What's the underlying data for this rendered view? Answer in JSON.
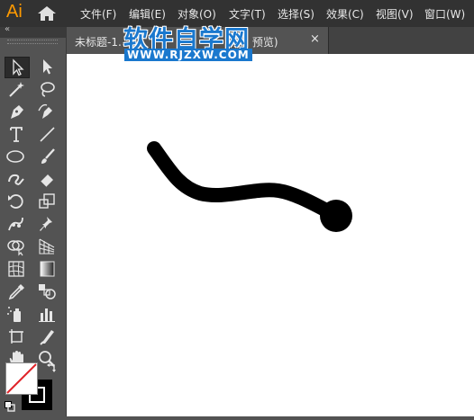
{
  "app": {
    "logo": "Ai"
  },
  "menu": [
    "文件(F)",
    "编辑(E)",
    "对象(O)",
    "文字(T)",
    "选择(S)",
    "效果(C)",
    "视图(V)",
    "窗口(W)"
  ],
  "tab": {
    "label_left": "未标题-1.",
    "label_right": "PU 预览)",
    "close": "×"
  },
  "watermark": {
    "title": "软件自学网",
    "url": "WWW.RJZXW.COM"
  },
  "colors": {
    "accent_logo": "#ff9a00",
    "watermark_blue": "#1a78ce",
    "stroke": "#000000",
    "fill": "#ffffff"
  },
  "tools": [
    [
      "selection-tool",
      "direct-selection-tool"
    ],
    [
      "magic-wand-tool",
      "lasso-tool"
    ],
    [
      "pen-tool",
      "curvature-tool"
    ],
    [
      "type-tool",
      "line-segment-tool"
    ],
    [
      "ellipse-tool",
      "paintbrush-tool"
    ],
    [
      "shaper-tool",
      "eraser-tool"
    ],
    [
      "rotate-tool",
      "scale-tool"
    ],
    [
      "puppet-warp-tool",
      "pin-tool"
    ],
    [
      "shape-builder-tool",
      "perspective-grid-tool"
    ],
    [
      "mesh-tool",
      "gradient-tool"
    ],
    [
      "eyedropper-tool",
      "blend-tool"
    ],
    [
      "symbol-sprayer-tool",
      "column-graph-tool"
    ],
    [
      "artboard-tool",
      "slice-tool"
    ],
    [
      "hand-tool",
      "zoom-tool"
    ]
  ],
  "selected_tool": "selection-tool"
}
